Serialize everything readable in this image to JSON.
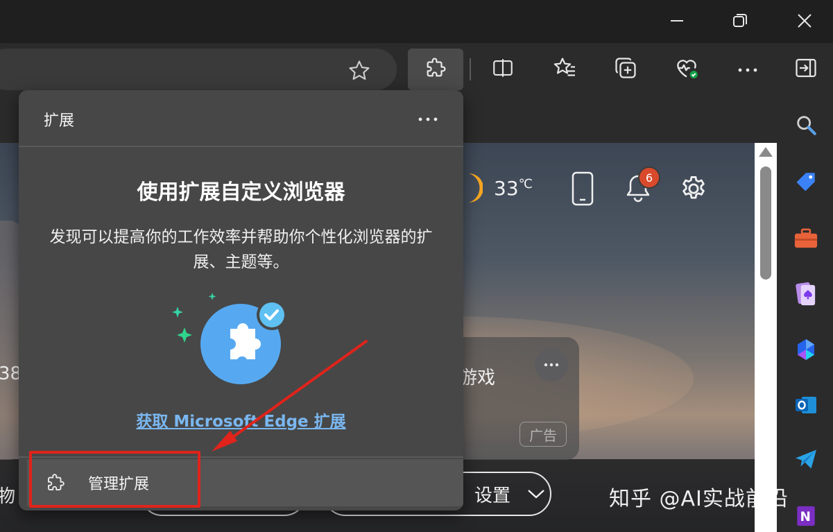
{
  "window": {
    "minimize_icon": "minimize-icon",
    "restore_icon": "restore-icon",
    "close_icon": "close-icon"
  },
  "toolbar": {
    "favorite_icon": "star-icon",
    "extensions_icon": "puzzle-icon",
    "split_icon": "split-screen-icon",
    "favorites_icon": "favorites-icon",
    "collections_icon": "collections-icon",
    "health_icon": "browser-essentials-icon",
    "more_icon": "more-icon",
    "sidebar_icon": "exit-sidebar-icon"
  },
  "ntp": {
    "temperature": "33",
    "temp_unit": "℃",
    "notification_count": "6",
    "left_card_number": "38",
    "right_card_text": "游戏",
    "ad_label": "广告",
    "left_pill_text": "物",
    "settings_pill_text": "设置"
  },
  "sidebar": {
    "items": [
      "search-icon",
      "tag-icon",
      "toolbox-icon",
      "games-icon",
      "copilot-icon",
      "outlook-icon",
      "send-icon",
      "onenote-icon"
    ]
  },
  "flyout": {
    "title": "扩展",
    "heading": "使用扩展自定义浏览器",
    "description": "发现可以提高你的工作效率并帮助你个性化浏览器的扩展、主题等。",
    "link": "获取 Microsoft Edge 扩展",
    "manage_label": "管理扩展"
  },
  "watermark": "知乎 @AI实战前沿",
  "colors": {
    "accent_link": "#7ab7f0",
    "annotation_red": "#e0231b",
    "badge": "#d94a2c",
    "flyout_bg": "#474747"
  }
}
